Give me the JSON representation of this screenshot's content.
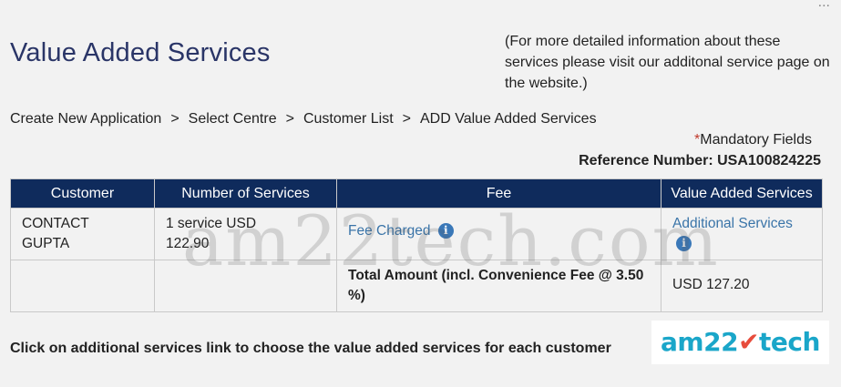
{
  "page": {
    "title": "Value Added Services",
    "info_note": "(For more detailed information about these services please visit our additonal service page on the website.)",
    "top_ellipsis": "..."
  },
  "breadcrumb": {
    "items": [
      "Create New Application",
      "Select Centre",
      "Customer List",
      "ADD Value Added Services"
    ],
    "separator": ">"
  },
  "mandatory": {
    "star": "*",
    "label": "Mandatory Fields"
  },
  "reference": {
    "text": "Reference Number: USA100824225"
  },
  "table": {
    "headers": [
      "Customer",
      "Number of Services",
      "Fee",
      "Value Added Services"
    ],
    "row1": {
      "customer": "CONTACT GUPTA",
      "services": "1 service USD 122.90",
      "fee_link": "Fee Charged",
      "vas_link": "Additional Services"
    },
    "row2": {
      "total_label": "Total Amount (incl. Convenience Fee @ 3.50 %)",
      "total_amount": "USD 127.20"
    },
    "info_icon_glyph": "i"
  },
  "footer": {
    "note": "Click on additional services link to choose the value added services for each customer"
  },
  "watermark": {
    "text": "am22tech.com"
  },
  "logo": {
    "text_left": "am22",
    "text_mark": "✔",
    "text_right": "tech"
  },
  "colors": {
    "title": "#2a3567",
    "header_bg": "#0f2b5c",
    "link": "#3a74a8",
    "brand": "#1aa6c9"
  },
  "icons": [
    "info-icon"
  ]
}
